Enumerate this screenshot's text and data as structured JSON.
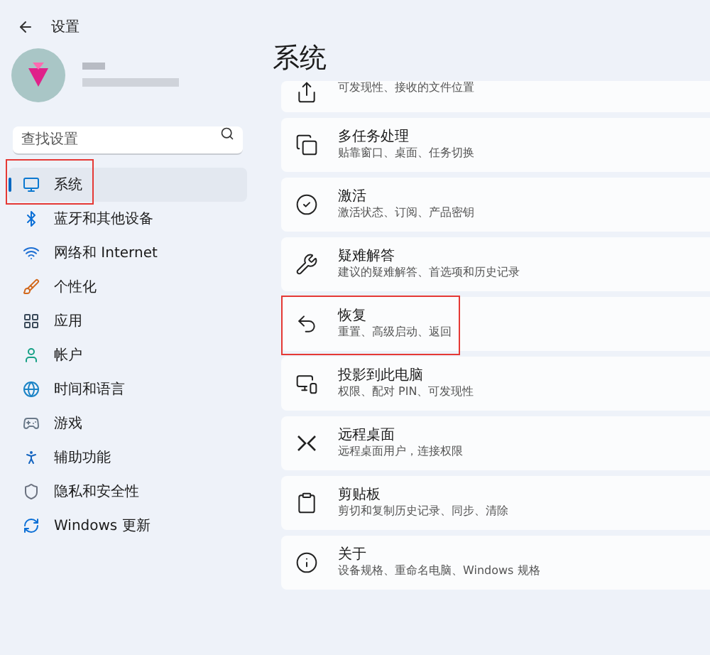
{
  "window": {
    "title": "设置"
  },
  "search": {
    "placeholder": "查找设置"
  },
  "sidebar": {
    "items": [
      {
        "label": "系统",
        "kind": "system",
        "selected": true,
        "highlighted": true
      },
      {
        "label": "蓝牙和其他设备",
        "kind": "bluetooth",
        "selected": false,
        "highlighted": false
      },
      {
        "label": "网络和 Internet",
        "kind": "network",
        "selected": false,
        "highlighted": false
      },
      {
        "label": "个性化",
        "kind": "brush",
        "selected": false,
        "highlighted": false
      },
      {
        "label": "应用",
        "kind": "apps",
        "selected": false,
        "highlighted": false
      },
      {
        "label": "帐户",
        "kind": "account",
        "selected": false,
        "highlighted": false
      },
      {
        "label": "时间和语言",
        "kind": "time",
        "selected": false,
        "highlighted": false
      },
      {
        "label": "游戏",
        "kind": "game",
        "selected": false,
        "highlighted": false
      },
      {
        "label": "辅助功能",
        "kind": "access",
        "selected": false,
        "highlighted": false
      },
      {
        "label": "隐私和安全性",
        "kind": "shield",
        "selected": false,
        "highlighted": false
      },
      {
        "label": "Windows 更新",
        "kind": "update",
        "selected": false,
        "highlighted": false
      }
    ]
  },
  "page": {
    "title": "系统",
    "cards": [
      {
        "kind": "share",
        "subtitle": "可发现性、接收的文件位置",
        "highlighted": false
      },
      {
        "kind": "multitask",
        "title": "多任务处理",
        "subtitle": "贴靠窗口、桌面、任务切换",
        "highlighted": false
      },
      {
        "kind": "check",
        "title": "激活",
        "subtitle": "激活状态、订阅、产品密钥",
        "highlighted": false
      },
      {
        "kind": "wrench",
        "title": "疑难解答",
        "subtitle": "建议的疑难解答、首选项和历史记录",
        "highlighted": false
      },
      {
        "kind": "recovery",
        "title": "恢复",
        "subtitle": "重置、高级启动、返回",
        "highlighted": true
      },
      {
        "kind": "project",
        "title": "投影到此电脑",
        "subtitle": "权限、配对 PIN、可发现性",
        "highlighted": false
      },
      {
        "kind": "remote",
        "title": "远程桌面",
        "subtitle": "远程桌面用户，连接权限",
        "highlighted": false
      },
      {
        "kind": "clipboard",
        "title": "剪贴板",
        "subtitle": "剪切和复制历史记录、同步、清除",
        "highlighted": false
      },
      {
        "kind": "info",
        "title": "关于",
        "subtitle": "设备规格、重命名电脑、Windows 规格",
        "highlighted": false
      }
    ]
  }
}
